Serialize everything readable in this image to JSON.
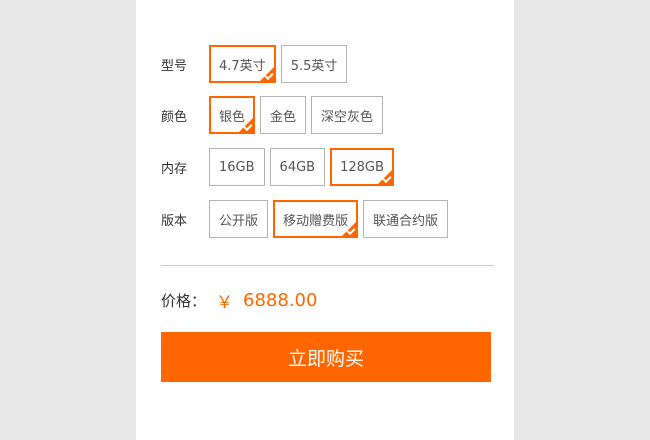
{
  "colors": {
    "accent": "#ff6600",
    "page_bg": "#e8e8e8",
    "card_bg": "#ffffff",
    "border": "#b4b4b4"
  },
  "options": {
    "model": {
      "label": "型号",
      "items": [
        "4.7英寸",
        "5.5英寸"
      ],
      "selected": "4.7英寸"
    },
    "color": {
      "label": "颜色",
      "items": [
        "银色",
        "金色",
        "深空灰色"
      ],
      "selected": "银色"
    },
    "storage": {
      "label": "内存",
      "items": [
        "16GB",
        "64GB",
        "128GB"
      ],
      "selected": "128GB"
    },
    "version": {
      "label": "版本",
      "items": [
        "公开版",
        "移动赠费版",
        "联通合约版"
      ],
      "selected": "移动赠费版"
    }
  },
  "price": {
    "label": "价格：",
    "currency": "￥",
    "value": "6888.00"
  },
  "buy_button": {
    "label": "立即购买"
  },
  "icons": {
    "selected_marker": "check-corner-icon"
  }
}
